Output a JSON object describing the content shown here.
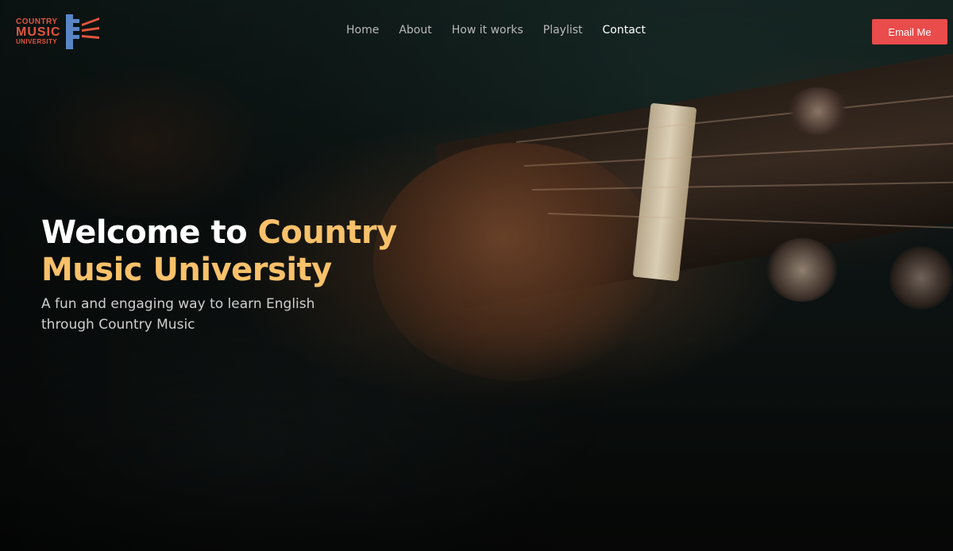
{
  "logo": {
    "line1": "COUNTRY",
    "line2": "MUSIC",
    "line3": "UNIVERSITY",
    "colors": {
      "text": "#e2563f",
      "flag_blue": "#5a86c6",
      "flag_red": "#e2563f"
    }
  },
  "nav": {
    "items": [
      {
        "label": "Home"
      },
      {
        "label": "About"
      },
      {
        "label": "How it works"
      },
      {
        "label": "Playlist"
      },
      {
        "label": "Contact",
        "active": true
      }
    ]
  },
  "header": {
    "email_button": "Email Me"
  },
  "hero": {
    "title_part1": "Welcome to ",
    "title_part2": "Country Music University",
    "subtitle": "A fun and engaging way to learn English through Country Music",
    "background_icon": "guitar-photo"
  },
  "colors": {
    "accent": "#f8c16a",
    "button": "#e94c4b",
    "nav_text": "#b9b9b9",
    "nav_active": "#ffffff"
  }
}
